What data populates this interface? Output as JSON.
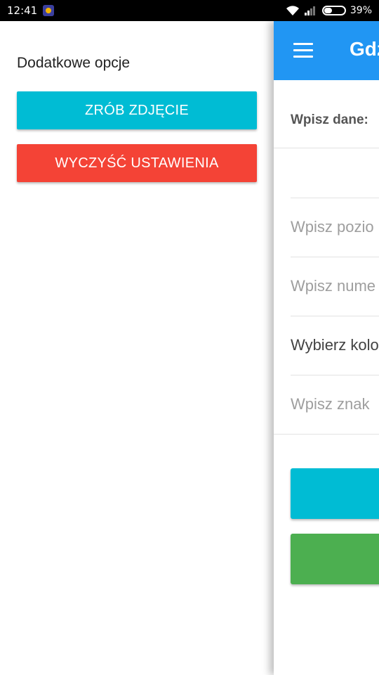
{
  "status_bar": {
    "time": "12:41",
    "app_icon": "notification-app-icon",
    "wifi_icon": "wifi-icon",
    "signal_icon": "signal-icon",
    "battery_percent": "39%",
    "battery_level": 0.39
  },
  "drawer": {
    "title": "Dodatkowe opcje",
    "photo_button_label": "ZRÓB ZDJĘCIE",
    "clear_button_label": "WYCZYŚĆ USTAWIENIA",
    "colors": {
      "photo": "#00bcd4",
      "clear": "#f44336"
    }
  },
  "main": {
    "appbar_title": "Gdz",
    "appbar_color": "#2196f3",
    "menu_icon": "hamburger-menu-icon",
    "form_label": "Wpisz dane:",
    "fields": [
      {
        "placeholder": "Wpisz pozio"
      },
      {
        "placeholder": "Wpisz nume"
      },
      {
        "value": "Wybierz kolo"
      },
      {
        "placeholder": "Wpisz znak"
      }
    ],
    "button_colors": {
      "primary": "#00bcd4",
      "secondary": "#4caf50"
    }
  }
}
